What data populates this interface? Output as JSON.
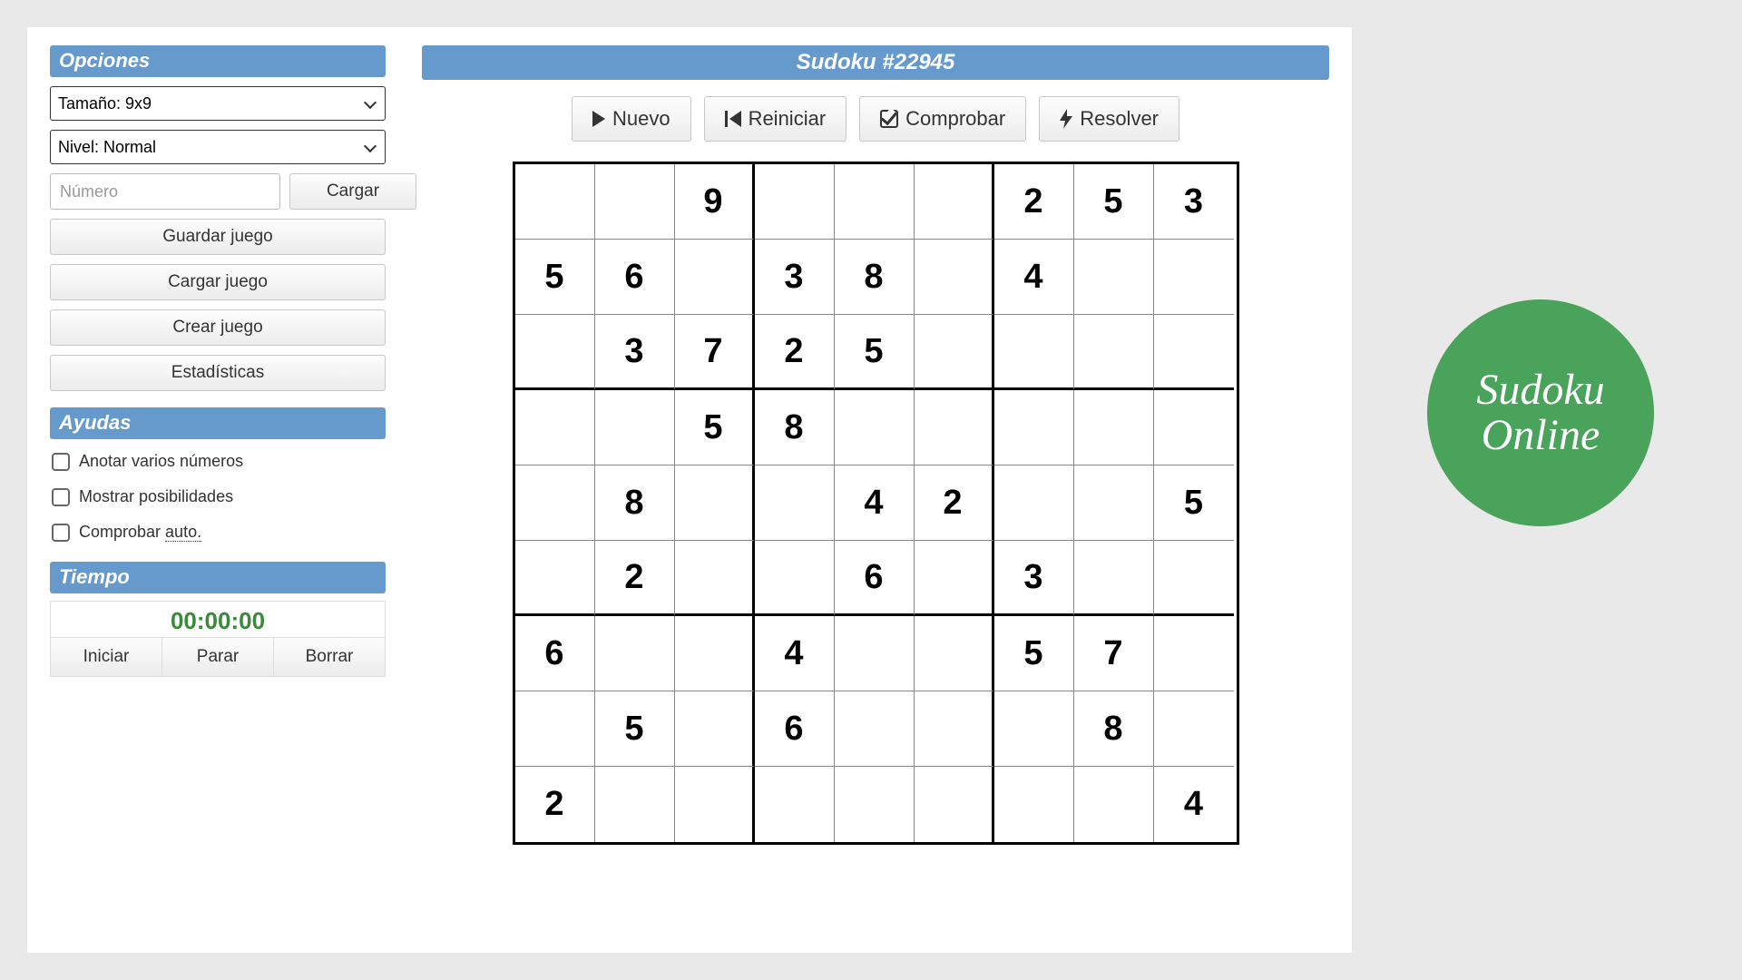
{
  "title": "Sudoku #22945",
  "logo": {
    "line1": "Sudoku",
    "line2": "Online"
  },
  "sidebar": {
    "options_header": "Opciones",
    "size_select": "Tamaño: 9x9",
    "level_select": "Nivel: Normal",
    "number_placeholder": "Número",
    "load_btn": "Cargar",
    "save_game": "Guardar juego",
    "load_game": "Cargar juego",
    "create_game": "Crear juego",
    "stats": "Estadísticas",
    "helps_header": "Ayudas",
    "help_multi": "Anotar varios números",
    "help_poss": "Mostrar posibilidades",
    "help_auto_pre": "Comprobar ",
    "help_auto_dotted": "auto.",
    "time_header": "Tiempo",
    "time_display": "00:00:00",
    "time_start": "Iniciar",
    "time_stop": "Parar",
    "time_clear": "Borrar"
  },
  "actions": {
    "new": "Nuevo",
    "restart": "Reiniciar",
    "check": "Comprobar",
    "solve": "Resolver"
  },
  "chart_data": {
    "type": "table",
    "title": "Sudoku #22945 givens (0 = empty)",
    "grid": [
      [
        0,
        0,
        9,
        0,
        0,
        0,
        2,
        5,
        3
      ],
      [
        5,
        6,
        0,
        3,
        8,
        0,
        4,
        0,
        0
      ],
      [
        0,
        3,
        7,
        2,
        5,
        0,
        0,
        0,
        0
      ],
      [
        0,
        0,
        5,
        8,
        0,
        0,
        0,
        0,
        0
      ],
      [
        0,
        8,
        0,
        0,
        4,
        2,
        0,
        0,
        5
      ],
      [
        0,
        2,
        0,
        0,
        6,
        0,
        3,
        0,
        0
      ],
      [
        6,
        0,
        0,
        4,
        0,
        0,
        5,
        7,
        0
      ],
      [
        0,
        5,
        0,
        6,
        0,
        0,
        0,
        8,
        0
      ],
      [
        2,
        0,
        0,
        0,
        0,
        0,
        0,
        0,
        4
      ]
    ]
  }
}
